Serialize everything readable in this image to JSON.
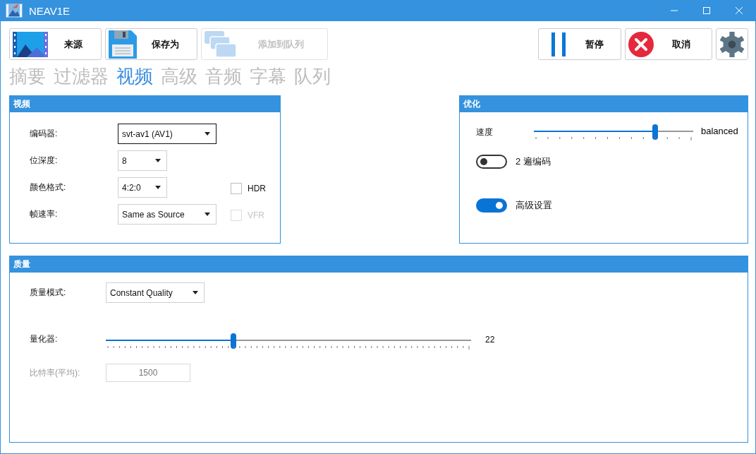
{
  "window": {
    "title": "NEAV1E"
  },
  "toolbar": {
    "left": [
      {
        "kind": "source",
        "label": "来源",
        "disabled": false
      },
      {
        "kind": "save",
        "label": "保存为",
        "disabled": false
      },
      {
        "kind": "queue",
        "label": "添加到队列",
        "disabled": true
      }
    ],
    "right": [
      {
        "kind": "pause",
        "label": "暂停"
      },
      {
        "kind": "cancel",
        "label": "取消"
      },
      {
        "kind": "settings"
      }
    ]
  },
  "tabs": [
    {
      "label": "摘要",
      "selected": false
    },
    {
      "label": "过滤器",
      "selected": false
    },
    {
      "label": "视频",
      "selected": true
    },
    {
      "label": "高级",
      "selected": false
    },
    {
      "label": "音频",
      "selected": false
    },
    {
      "label": "字幕",
      "selected": false
    },
    {
      "label": "队列",
      "selected": false
    }
  ],
  "video": {
    "title": "视频",
    "rows": [
      {
        "label": "编码器:",
        "value": "svt-av1 (AV1)",
        "focused": true
      },
      {
        "label": "位深度:",
        "value": "8",
        "focused": false
      },
      {
        "label": "颜色格式:",
        "value": "4:2:0",
        "focused": false,
        "checkbox": {
          "label": "HDR",
          "checked": false,
          "disabled": false
        }
      },
      {
        "label": "帧速率:",
        "value": "Same as Source",
        "focused": false,
        "checkbox": {
          "label": "VFR",
          "checked": false,
          "disabled": true
        }
      }
    ]
  },
  "optimization": {
    "title": "优化",
    "speed": {
      "label": "速度",
      "level": 0.76,
      "reading": "balanced"
    },
    "toggles": [
      {
        "label": "2 遍编码",
        "on": false
      },
      {
        "label": "高级设置",
        "on": true
      }
    ]
  },
  "quality": {
    "title": "质量",
    "mode": {
      "label": "质量模式:",
      "value": "Constant Quality"
    },
    "quantizer": {
      "label": "量化器:",
      "level": 0.35,
      "reading": "22"
    },
    "bitrate": {
      "label": "比特率(平均):",
      "value": "1500",
      "disabled": true
    }
  }
}
